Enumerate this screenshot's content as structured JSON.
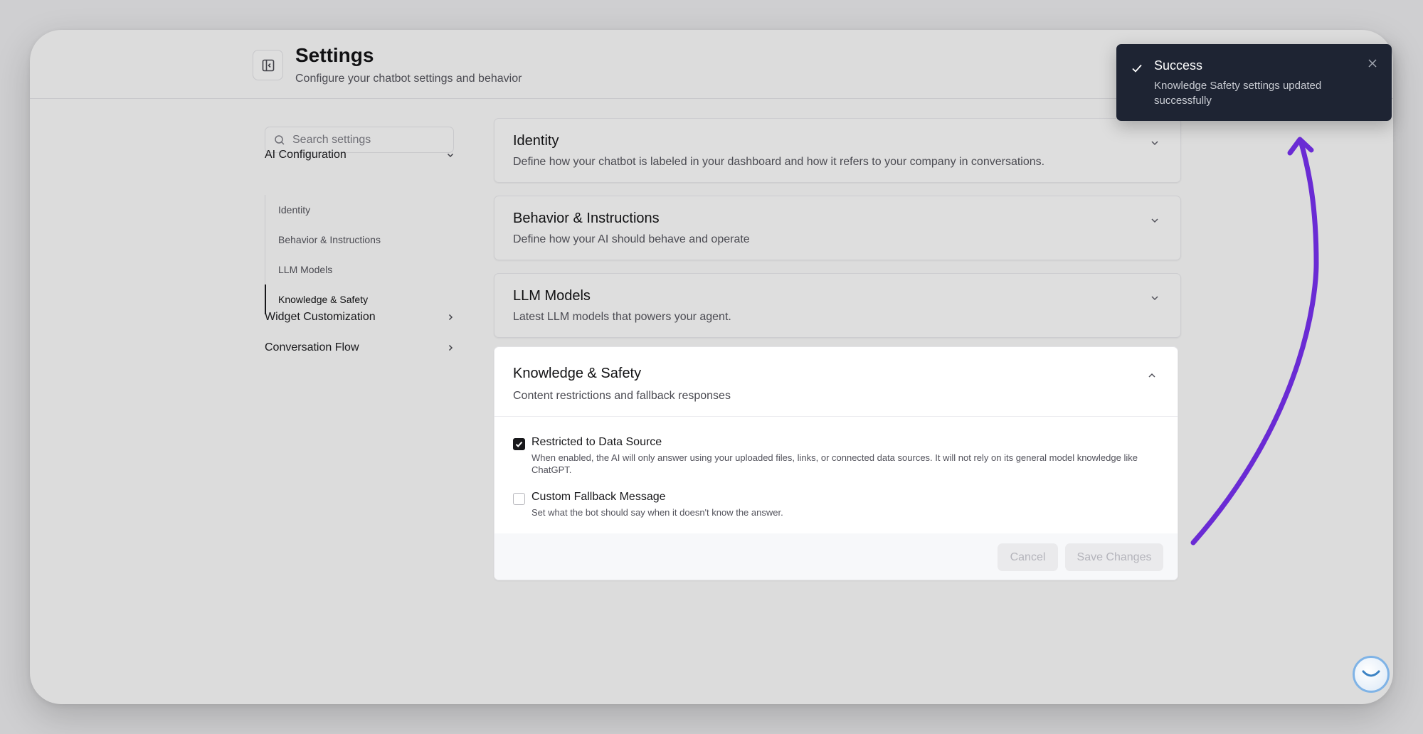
{
  "header": {
    "title": "Settings",
    "subtitle": "Configure your chatbot settings and behavior"
  },
  "sidebar": {
    "search_placeholder": "Search settings",
    "groups": [
      {
        "label": "AI Configuration",
        "expanded": true,
        "items": [
          {
            "label": "Identity"
          },
          {
            "label": "Behavior & Instructions"
          },
          {
            "label": "LLM Models"
          },
          {
            "label": "Knowledge & Safety",
            "active": true
          }
        ]
      },
      {
        "label": "Widget Customization",
        "expanded": false
      },
      {
        "label": "Conversation Flow",
        "expanded": false
      }
    ]
  },
  "sections": [
    {
      "title": "Identity",
      "description": "Define how your chatbot is labeled in your dashboard and how it refers to your company in conversations."
    },
    {
      "title": "Behavior & Instructions",
      "description": "Define how your AI should behave and operate"
    },
    {
      "title": "LLM Models",
      "description": "Latest LLM models that powers your agent."
    },
    {
      "title": "Knowledge & Safety",
      "description": "Content restrictions and fallback responses",
      "options": [
        {
          "label": "Restricted to Data Source",
          "checked": true,
          "description": "When enabled, the AI will only answer using your uploaded files, links, or connected data sources. It will not rely on its general model knowledge like ChatGPT."
        },
        {
          "label": "Custom Fallback Message",
          "checked": false,
          "description": "Set what the bot should say when it doesn't know the answer."
        }
      ],
      "buttons": {
        "cancel": "Cancel",
        "save": "Save Changes"
      }
    }
  ],
  "toast": {
    "title": "Success",
    "message": "Knowledge Safety settings updated successfully"
  },
  "colors": {
    "accent_arrow": "#6a2bd4",
    "toast_bg": "#1e2433"
  },
  "icons": {
    "collapse": "sidebar-collapse-icon",
    "search": "search-icon",
    "toast": "check-icon",
    "close": "close-icon",
    "chat": "chat-widget-icon"
  }
}
